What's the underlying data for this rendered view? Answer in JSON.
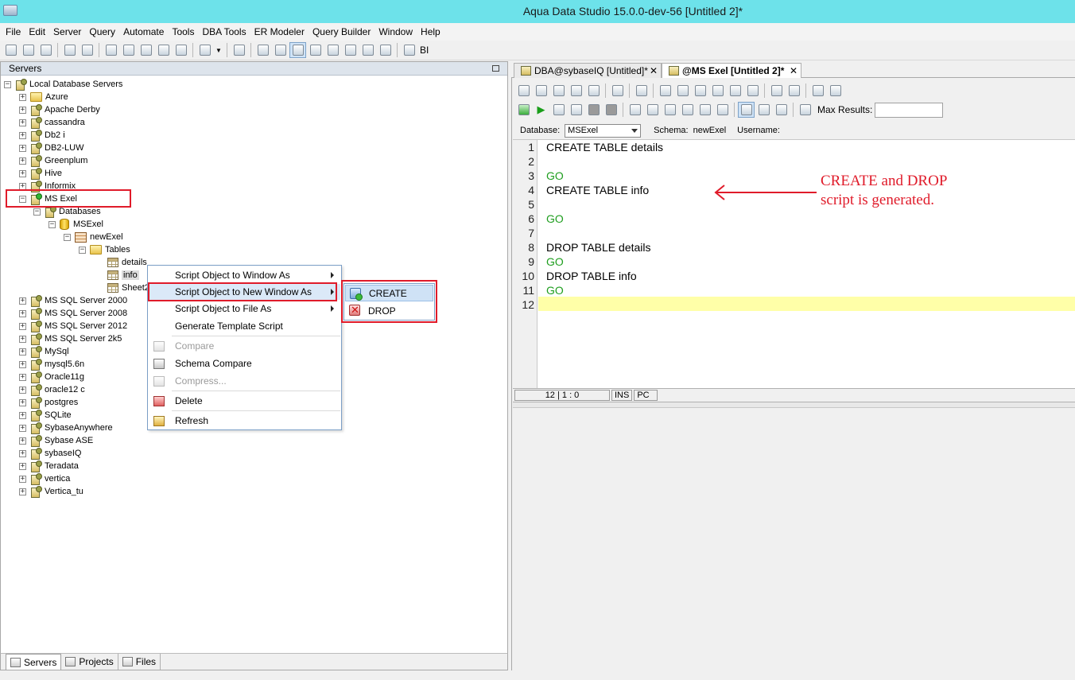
{
  "window": {
    "title": "Aqua Data Studio 15.0.0-dev-56 [Untitled 2]*"
  },
  "menubar": [
    "File",
    "Edit",
    "Server",
    "Query",
    "Automate",
    "Tools",
    "DBA Tools",
    "ER Modeler",
    "Query Builder",
    "Window",
    "Help"
  ],
  "toolbar": {
    "bi_label": "BI"
  },
  "servers_panel": {
    "title": "Servers",
    "root": "Local Database Servers",
    "servers": [
      "Azure",
      "Apache Derby",
      "cassandra",
      "Db2 i",
      "DB2-LUW",
      "Greenplum",
      "Hive",
      "Informix",
      "MS Exel"
    ],
    "ms_exel_children": {
      "databases": "Databases",
      "database": "MSExel",
      "schema": "newExel",
      "tables_folder": "Tables",
      "tables": [
        "details",
        "info",
        "Sheet2"
      ]
    },
    "servers_after": [
      "MS SQL Server 2000",
      "MS SQL Server 2008",
      "MS SQL Server 2012",
      "MS SQL Server 2k5",
      "MySql",
      "mysql5.6n",
      "Oracle11g",
      "oracle12 c",
      "postgres",
      "SQLite",
      "SybaseAnywhere",
      "Sybase ASE",
      "sybaseIQ",
      "Teradata",
      "vertica",
      "Vertica_tu"
    ]
  },
  "context_menu": {
    "items": [
      {
        "label": "Script Object to Window As"
      },
      {
        "label": "Script Object to New Window As"
      },
      {
        "label": "Script Object to File As"
      },
      {
        "label": "Generate Template Script"
      },
      {
        "label": "Compare"
      },
      {
        "label": "Schema Compare"
      },
      {
        "label": "Compress..."
      },
      {
        "label": "Delete"
      },
      {
        "label": "Refresh"
      }
    ],
    "submenu": [
      "CREATE",
      "DROP"
    ]
  },
  "bottom_tabs": [
    "Servers",
    "Projects",
    "Files"
  ],
  "editor_tabs": [
    "DBA@sybaseIQ [Untitled]*",
    "@MS Exel [Untitled 2]*"
  ],
  "query_toolbar": {
    "max_results_label": "Max Results:",
    "max_results_value": ""
  },
  "db_bar": {
    "database_label": "Database:",
    "database_value": "MSExel",
    "schema_label": "Schema:",
    "schema_value": "newExel",
    "username_label": "Username:"
  },
  "editor": {
    "line_numbers": [
      "1",
      "2",
      "3",
      "4",
      "5",
      "6",
      "7",
      "8",
      "9",
      "10",
      "11",
      "12"
    ],
    "lines": [
      "CREATE TABLE details",
      "",
      "GO",
      "CREATE TABLE info",
      "",
      "GO",
      "",
      "DROP TABLE details",
      "GO",
      "DROP TABLE info",
      "GO",
      ""
    ]
  },
  "status_bar": {
    "position": "12 | 1 : 0",
    "ins": "INS",
    "pc": "PC"
  },
  "annotation": {
    "line1": "CREATE and DROP",
    "line2": "script is generated."
  },
  "colors": {
    "title_bar": "#6de2ea",
    "highlight_red": "#e01b2a",
    "keyword_green": "#1f9e1f",
    "current_line": "#ffffa8"
  }
}
